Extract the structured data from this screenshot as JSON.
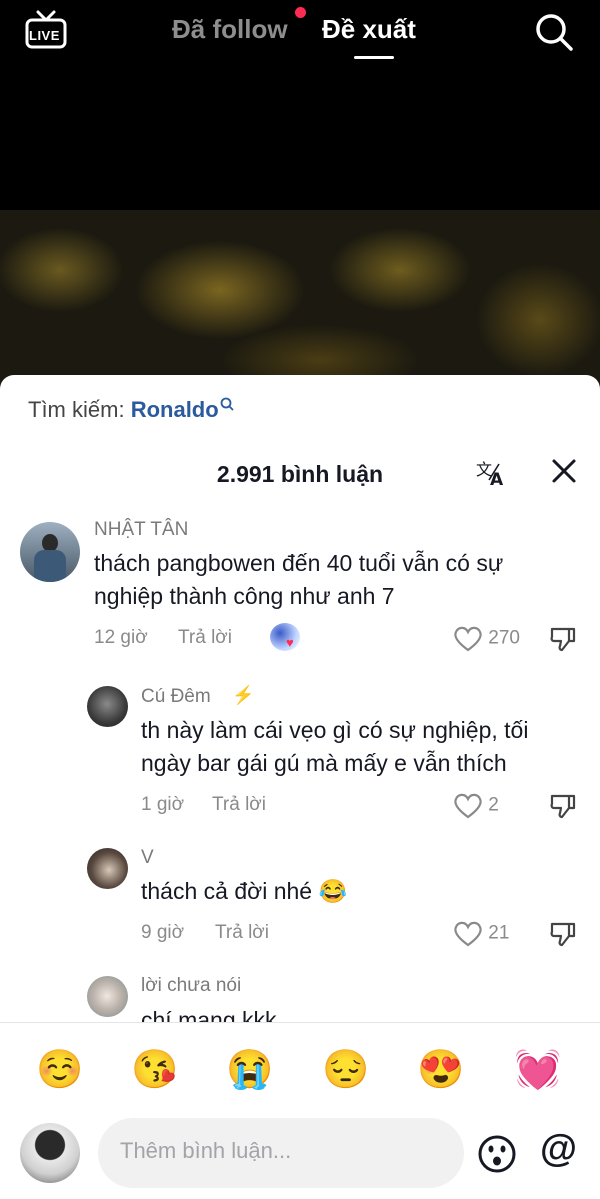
{
  "header": {
    "live_label": "LIVE",
    "tab_following": "Đã follow",
    "tab_suggested": "Đề xuất"
  },
  "sheet": {
    "search_prefix": "Tìm kiếm:",
    "search_term": "Ronaldo",
    "comment_count": "2.991 bình luận"
  },
  "comments": [
    {
      "name": "NHẬT TÂN",
      "text_line1": "thách pangbowen đến 40 tuổi vẫn có sự",
      "text_line2": "nghiệp thành công như anh 7",
      "time": "12 giờ",
      "reply": "Trả lời",
      "likes": "270"
    },
    {
      "name": "Cú Đêm",
      "badge": "⚡",
      "text_line1": "th này làm cái vẹo gì có sự nghiệp, tối",
      "text_line2": "ngày bar gái gú mà mấy e vẫn thích",
      "time": "1 giờ",
      "reply": "Trả lời",
      "likes": "2"
    },
    {
      "name": "V",
      "text_line1": "thách cả đời nhé 😂",
      "time": "9 giờ",
      "reply": "Trả lời",
      "likes": "21"
    },
    {
      "name": "lời chưa nói",
      "text_line1": "chí mạng kkk"
    }
  ],
  "emoji_bar": [
    "☺️",
    "😘",
    "😭",
    "😔",
    "😍",
    "💓"
  ],
  "composer": {
    "placeholder": "Thêm bình luận...",
    "at_symbol": "@"
  },
  "colors": {
    "accent_red": "#fe2c55",
    "link_blue": "#2b5a9e"
  }
}
